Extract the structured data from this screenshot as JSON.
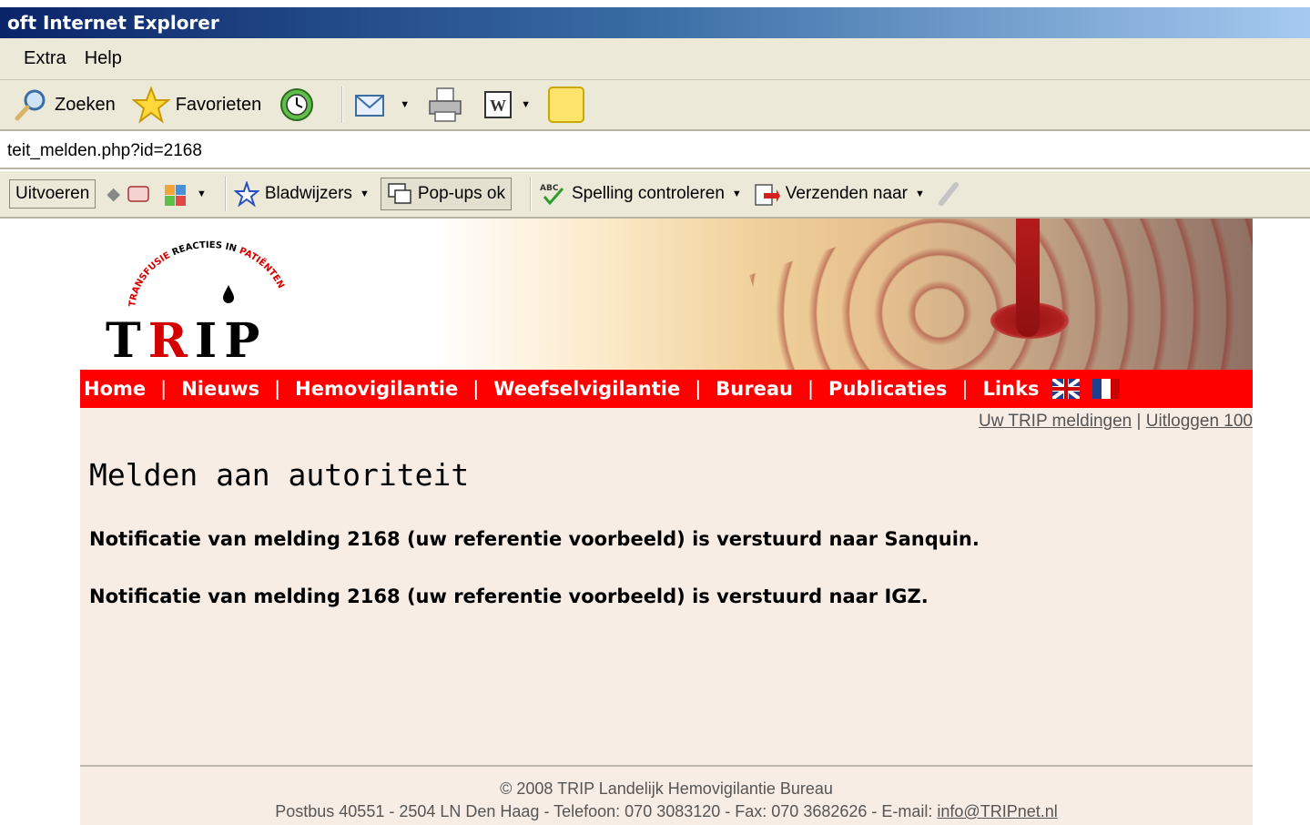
{
  "window": {
    "title": "oft Internet Explorer"
  },
  "menubar": {
    "items": [
      "Extra",
      "Help"
    ]
  },
  "toolbar": {
    "search_label": "Zoeken",
    "favorites_label": "Favorieten"
  },
  "address": {
    "url": "teit_melden.php?id=2168"
  },
  "google_toolbar": {
    "run_label": "Uitvoeren",
    "bookmarks_label": "Bladwijzers",
    "popups_label": "Pop-ups ok",
    "spellcheck_label": "Spelling controleren",
    "send_label": "Verzenden naar",
    "abc_label": "ABC"
  },
  "site": {
    "logo_arc_text": "TRANSFUSIE REACTIES IN PATIËNTEN",
    "logo_text": [
      "T",
      "R",
      "I",
      "P"
    ],
    "nav": [
      "Home",
      "Nieuws",
      "Hemovigilantie",
      "Weefselvigilantie",
      "Bureau",
      "Publicaties",
      "Links"
    ],
    "user_links": {
      "meldingen": "Uw TRIP meldingen",
      "separator": "|",
      "logout": "Uitloggen 100"
    }
  },
  "main": {
    "heading": "Melden aan autoriteit",
    "messages": [
      "Notificatie van melding 2168 (uw referentie voorbeeld) is verstuurd naar Sanquin.",
      "Notificatie van melding 2168 (uw referentie voorbeeld) is verstuurd naar IGZ."
    ]
  },
  "footer": {
    "copyright": "© 2008 TRIP Landelijk Hemovigilantie Bureau",
    "address": "Postbus 40551 - 2504 LN Den Haag - Telefoon: 070 3083120 - Fax: 070 3682626 - E-mail: ",
    "email": "info@TRIPnet.nl"
  },
  "colors": {
    "nav_bg": "#ff0000",
    "page_bg": "#f7ede4",
    "chrome_bg": "#ece9d8",
    "title_bar": "#0a246a"
  }
}
